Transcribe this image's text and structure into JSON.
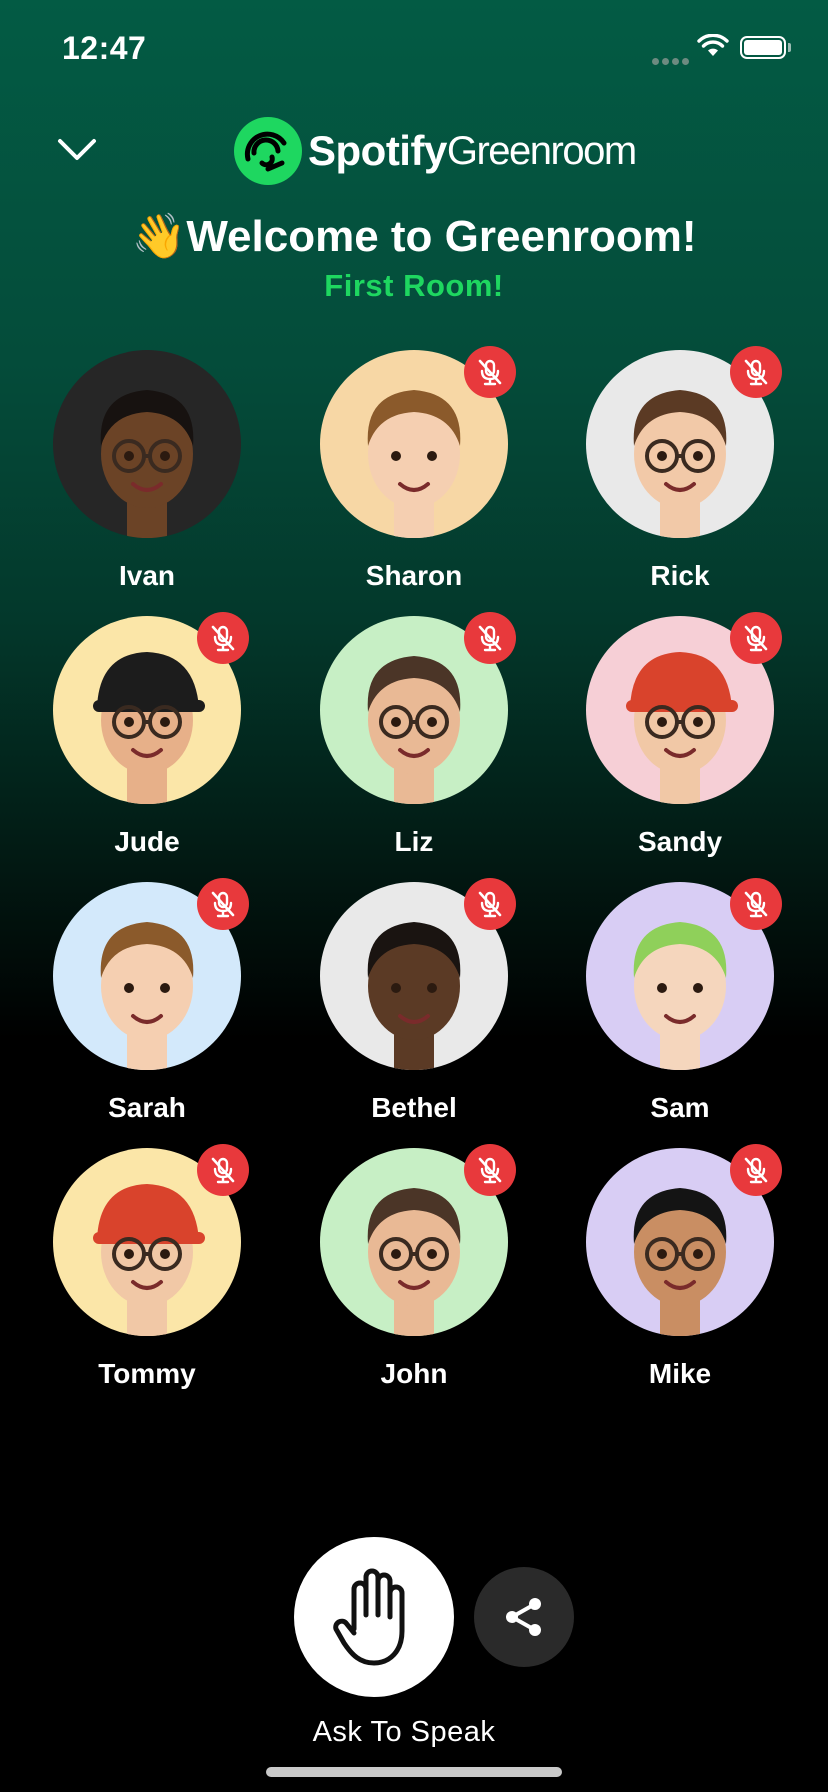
{
  "status_bar": {
    "time": "12:47"
  },
  "logo": {
    "brand": "Spotify",
    "product": "Greenroom"
  },
  "header": {
    "welcome_emoji": "👋",
    "welcome_text": "Welcome to Greenroom!",
    "room_name": "First Room!"
  },
  "participants": [
    {
      "name": "Ivan",
      "muted": false,
      "avatar_bg": "#262626",
      "skin": "#6b4326",
      "hair": "#171210",
      "glasses": true,
      "hat": null
    },
    {
      "name": "Sharon",
      "muted": true,
      "avatar_bg": "#f7d7a5",
      "skin": "#f5cfb1",
      "hair": "#8b5a2b",
      "glasses": false,
      "hat": null
    },
    {
      "name": "Rick",
      "muted": true,
      "avatar_bg": "#e9e9e9",
      "skin": "#f2c9a8",
      "hair": "#5b3a24",
      "glasses": true,
      "hat": null
    },
    {
      "name": "Jude",
      "muted": true,
      "avatar_bg": "#fbe6a8",
      "skin": "#e7b089",
      "hair": "#1d1d1d",
      "glasses": true,
      "hat": "#1c1c1c"
    },
    {
      "name": "Liz",
      "muted": true,
      "avatar_bg": "#c7efc5",
      "skin": "#e9b995",
      "hair": "#4b3527",
      "glasses": true,
      "hat": null
    },
    {
      "name": "Sandy",
      "muted": true,
      "avatar_bg": "#f6cfd6",
      "skin": "#f1c8a6",
      "hair": "#d9432c",
      "glasses": true,
      "hat": "#d9432c"
    },
    {
      "name": "Sarah",
      "muted": true,
      "avatar_bg": "#d3e9fb",
      "skin": "#f5cfb1",
      "hair": "#8b5a2b",
      "glasses": false,
      "hat": null
    },
    {
      "name": "Bethel",
      "muted": true,
      "avatar_bg": "#e9e9e9",
      "skin": "#5b3a25",
      "hair": "#1a1411",
      "glasses": false,
      "hat": null
    },
    {
      "name": "Sam",
      "muted": true,
      "avatar_bg": "#d8cdf4",
      "skin": "#f5d6bd",
      "hair": "#8fd05a",
      "glasses": false,
      "hat": null
    },
    {
      "name": "Tommy",
      "muted": true,
      "avatar_bg": "#fbe6a8",
      "skin": "#f1c8a6",
      "hair": "#d9432c",
      "glasses": true,
      "hat": "#d9432c"
    },
    {
      "name": "John",
      "muted": true,
      "avatar_bg": "#c7efc5",
      "skin": "#e9b995",
      "hair": "#4b3527",
      "glasses": true,
      "hat": null
    },
    {
      "name": "Mike",
      "muted": true,
      "avatar_bg": "#d8cdf4",
      "skin": "#c98e63",
      "hair": "#141414",
      "glasses": true,
      "hat": null
    }
  ],
  "actions": {
    "ask_to_speak": "Ask To Speak"
  },
  "colors": {
    "accent": "#1ed760",
    "muted_badge": "#e8393c",
    "bg_top": "#035b44",
    "bg_bottom": "#000000"
  }
}
